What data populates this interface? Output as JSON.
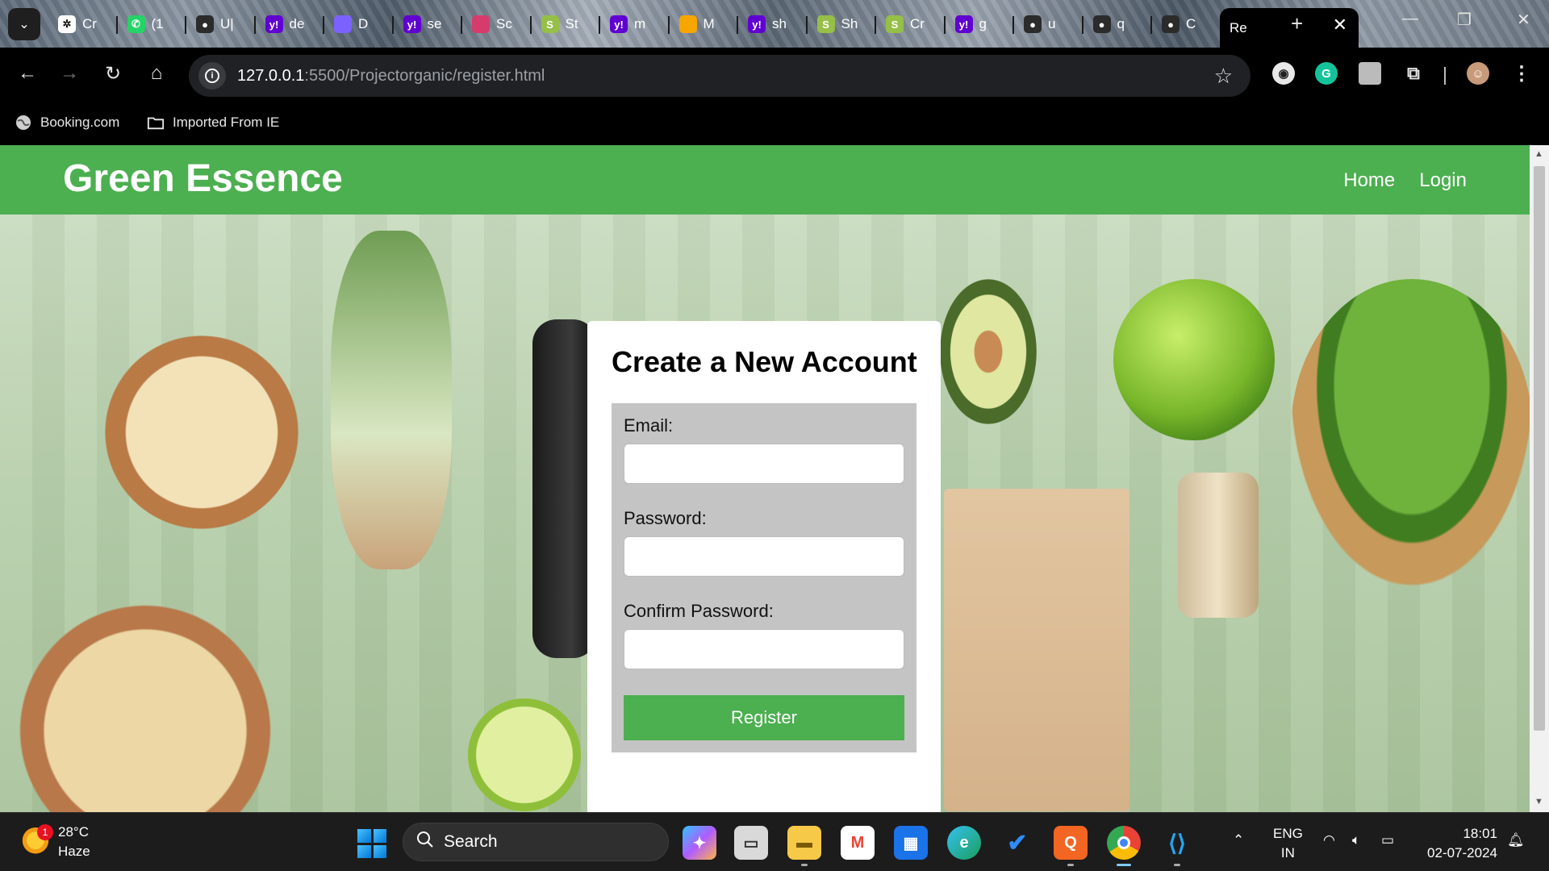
{
  "browser": {
    "tabs": [
      {
        "label": "Cr",
        "icon": "chatgpt-icon",
        "color": "#ffffff"
      },
      {
        "label": "(1",
        "icon": "whatsapp-icon",
        "color": "#25d366"
      },
      {
        "label": "U|",
        "icon": "github-icon",
        "color": "#2b2b2b"
      },
      {
        "label": "de",
        "icon": "yahoo-icon",
        "color": "#6001d2"
      },
      {
        "label": "D",
        "icon": "copilot-icon",
        "color": "#7b61ff"
      },
      {
        "label": "se",
        "icon": "yahoo-icon",
        "color": "#6001d2"
      },
      {
        "label": "Sc",
        "icon": "stripes-icon",
        "color": "#d63c6b"
      },
      {
        "label": "St",
        "icon": "shopify-icon",
        "color": "#95bf47"
      },
      {
        "label": "m",
        "icon": "yahoo-icon",
        "color": "#6001d2"
      },
      {
        "label": "M",
        "icon": "spark-icon",
        "color": "#f7a600"
      },
      {
        "label": "sh",
        "icon": "yahoo-icon",
        "color": "#6001d2"
      },
      {
        "label": "Sh",
        "icon": "shopify-icon",
        "color": "#95bf47"
      },
      {
        "label": "Cr",
        "icon": "shopify-icon",
        "color": "#95bf47"
      },
      {
        "label": "g",
        "icon": "yahoo-icon",
        "color": "#6001d2"
      },
      {
        "label": "u",
        "icon": "github-icon",
        "color": "#2b2b2b"
      },
      {
        "label": "q",
        "icon": "github-icon",
        "color": "#2b2b2b"
      },
      {
        "label": "C",
        "icon": "github-icon",
        "color": "#2b2b2b"
      }
    ],
    "active_tab": {
      "label": "Re",
      "close": "✕"
    },
    "new_tab": "+",
    "url_host": "127.0.0.1",
    "url_rest": ":5500/Projectorganic/register.html",
    "bookmarks": [
      {
        "label": "Booking.com",
        "icon": "globe-icon"
      },
      {
        "label": "Imported From IE",
        "icon": "folder-icon"
      }
    ]
  },
  "page": {
    "brand": "Green Essence",
    "nav": {
      "home": "Home",
      "login": "Login"
    },
    "form": {
      "title": "Create a New Account",
      "email_label": "Email:",
      "password_label": "Password:",
      "confirm_label": "Confirm Password:",
      "submit": "Register"
    },
    "colors": {
      "accent": "#4caf50",
      "form_bg": "#c4c4c4"
    }
  },
  "taskbar": {
    "weather_temp": "28°C",
    "weather_desc": "Haze",
    "weather_badge": "1",
    "search_label": "Search",
    "lang_top": "ENG",
    "lang_bottom": "IN",
    "time": "18:01",
    "date": "02-07-2024"
  }
}
